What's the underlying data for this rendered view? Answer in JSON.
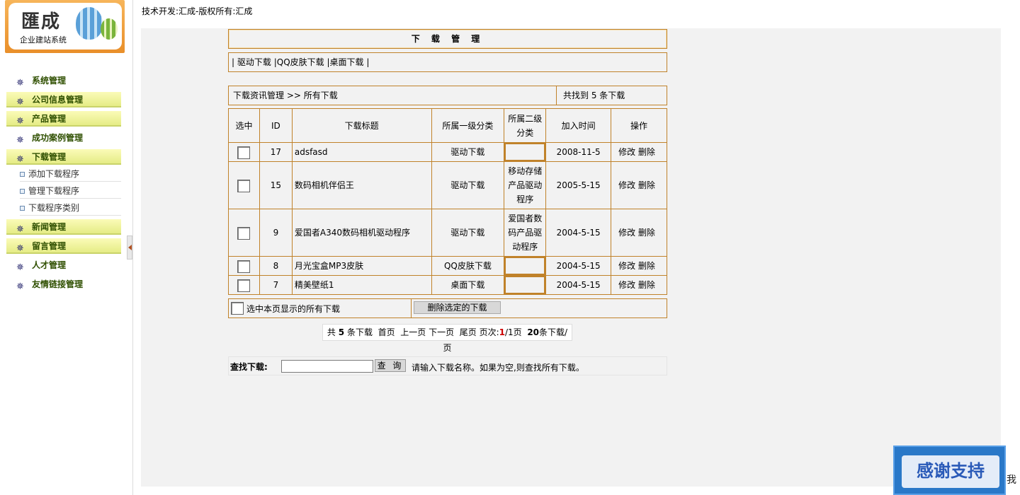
{
  "logo": {
    "title": "匯成",
    "subtitle": "企业建站系统"
  },
  "top_credit": "技术开发:汇成-版权所有:汇成",
  "sidebar": {
    "items": [
      {
        "label": "系统管理",
        "style": "plain"
      },
      {
        "label": "公司信息管理",
        "style": "bar"
      },
      {
        "label": "产品管理",
        "style": "bar"
      },
      {
        "label": "成功案例管理",
        "style": "plain"
      },
      {
        "label": "下载管理",
        "style": "bar"
      },
      {
        "label": "新闻管理",
        "style": "bar"
      },
      {
        "label": "留言管理",
        "style": "bar"
      },
      {
        "label": "人才管理",
        "style": "plain"
      },
      {
        "label": "友情链接管理",
        "style": "plain"
      }
    ],
    "subitems": [
      "添加下载程序",
      "管理下载程序",
      "下载程序类别"
    ]
  },
  "panel_title": "下 载 管 理",
  "links": {
    "sep": "|",
    "items": [
      "驱动下载",
      "QQ皮肤下载",
      "桌面下载"
    ]
  },
  "crumb": {
    "left": "下载资讯管理 >> 所有下载",
    "right": "共找到 5 条下载"
  },
  "table": {
    "headers": [
      "选中",
      "ID",
      "下载标题",
      "所属一级分类",
      "所属二级分类",
      "加入时间",
      "操作"
    ],
    "rows": [
      {
        "id": "17",
        "title": "adsfasd",
        "cat1": "驱动下载",
        "cat2": "",
        "date": "2008-11-5"
      },
      {
        "id": "15",
        "title": "数码相机伴侣王",
        "cat1": "驱动下载",
        "cat2": "移动存储产品驱动程序",
        "date": "2005-5-15"
      },
      {
        "id": "9",
        "title": "爱国者A340数码相机驱动程序",
        "cat1": "驱动下载",
        "cat2": "爱国者数码产品驱动程序",
        "date": "2004-5-15"
      },
      {
        "id": "8",
        "title": "月光宝盒MP3皮肤",
        "cat1": "QQ皮肤下载",
        "cat2": "",
        "date": "2004-5-15"
      },
      {
        "id": "7",
        "title": "精美壁纸1",
        "cat1": "桌面下载",
        "cat2": "",
        "date": "2004-5-15"
      }
    ],
    "edit_label": "修改",
    "delete_label": "删除"
  },
  "footer": {
    "select_all_label": "选中本页显示的所有下载",
    "delete_selected_label": "删除选定的下载"
  },
  "pager": {
    "prefix": "共",
    "total": "5",
    "unit": "条下载",
    "first": "首页",
    "prev": "上一页",
    "next": "下一页",
    "last": "尾页",
    "page_label": "页次:",
    "current": "1",
    "total_pages": "/1页",
    "per_page": "20",
    "per_page_unit": "条下载/页"
  },
  "search": {
    "label": "查找下载:",
    "input_value": "",
    "button_label": "查 询",
    "hint": "请输入下载名称。如果为空,则查找所有下载。"
  },
  "badge": {
    "text": "感谢支持"
  },
  "edge_char": "我"
}
